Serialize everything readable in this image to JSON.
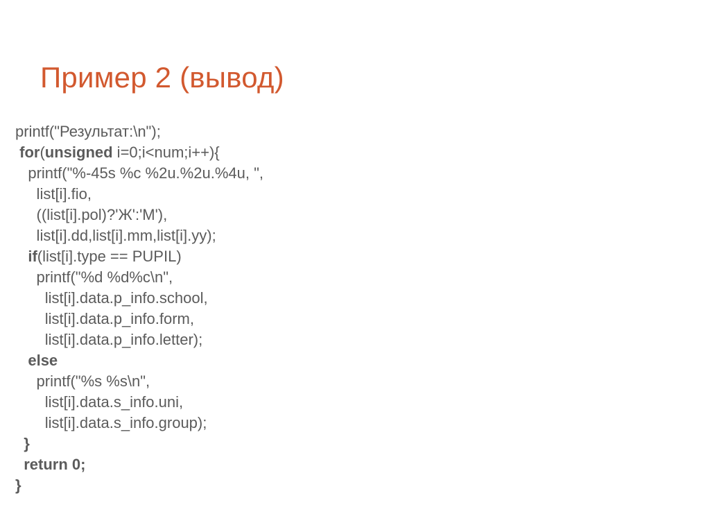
{
  "title": "Пример 2 (вывод)",
  "code": {
    "l01a": "printf(\"Результат:\\n\");",
    "l02a": " ",
    "l02b": "for",
    "l02c": "(",
    "l02d": "unsigned",
    "l02e": " i=0;i<num;i++){",
    "l03a": "   printf(\"%-45s %c %2u.%2u.%4u, \",",
    "l04a": "     list[i].fio,",
    "l05a": "     ((list[i].pol)?'Ж':'М'),",
    "l06a": "     list[i].dd,list[i].mm,list[i].yy);",
    "l07a": "   ",
    "l07b": "if",
    "l07c": "(list[i].type == PUPIL)",
    "l08a": "     printf(\"%d %d%c\\n\",",
    "l09a": "       list[i].data.p_info.school,",
    "l10a": "       list[i].data.p_info.form,",
    "l11a": "       list[i].data.p_info.letter);",
    "l12a": "   ",
    "l12b": "else",
    "l13a": "     printf(\"%s %s\\n\",",
    "l14a": "       list[i].data.s_info.uni,",
    "l15a": "       list[i].data.s_info.group);",
    "l16a": "  }",
    "l17a": "  ",
    "l17b": "return",
    "l17c": " 0;",
    "l18a": "}"
  }
}
